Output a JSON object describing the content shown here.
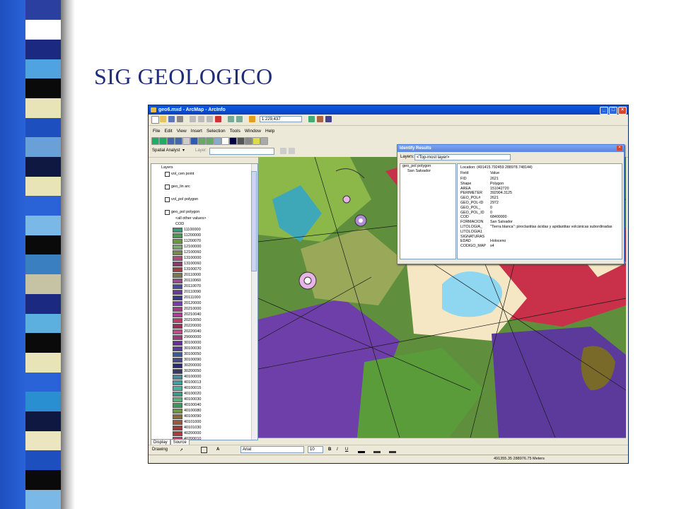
{
  "slide": {
    "title": "SIG GEOLOGICO"
  },
  "window": {
    "title": "geo6.mxd - ArcMap - ArcInfo",
    "scale": "1:229,437",
    "menu": [
      "File",
      "Edit",
      "View",
      "Insert",
      "Selection",
      "Tools",
      "Window",
      "Help"
    ],
    "spatial_analyst": "Spatial Analyst",
    "layer_label": "Layer:"
  },
  "toc": {
    "root": "Layers",
    "layers": [
      "vol_cen point",
      "geo_lin arc",
      "vol_pol polygon",
      "geo_pol polygon"
    ],
    "other_values": "<all other values>",
    "field": "COD",
    "codes": [
      "11100000",
      "11200000",
      "11200070",
      "12100000",
      "12100060",
      "13100000",
      "13100060",
      "13100070",
      "20110000",
      "20110060",
      "20110070",
      "20110090",
      "20111000",
      "20120000",
      "20210000",
      "20210040",
      "20210050",
      "20220000",
      "20220040",
      "29000000",
      "30100000",
      "30100030",
      "30100050",
      "30100090",
      "30200000",
      "30200050",
      "40100000",
      "40100013",
      "40100015",
      "40100020",
      "40100030",
      "40100040",
      "40100080",
      "40100090",
      "40101000",
      "40101030",
      "40200000",
      "40200010",
      "40200040"
    ],
    "tabs": [
      "Display",
      "Source"
    ]
  },
  "identify": {
    "title": "Identify Results",
    "layers_label": "Layers:",
    "layers_value": "<Top-most layer>",
    "tree_root": "geo_pol polygon",
    "tree_child": "San Salvador",
    "location": "Location: (491415.792459 288978.748144)",
    "headers": [
      "Field",
      "Value"
    ],
    "rows": [
      [
        "FID",
        "2621"
      ],
      [
        "Shape",
        "Polygon"
      ],
      [
        "AREA",
        "151042720"
      ],
      [
        "PERIMETER",
        "392904.3125"
      ],
      [
        "GEO_POL#",
        "2621"
      ],
      [
        "GEO_POL-ID",
        "2972"
      ],
      [
        "GEO_POL_",
        "0"
      ],
      [
        "GEO_POL_ID",
        "0"
      ],
      [
        "COD",
        "68400000"
      ],
      [
        "FORMACION",
        "San Salvador"
      ],
      [
        "LITOLOGIA_",
        "\"Tierra blanca\": piroclastitas ácidas y apidastitas volcánicas subordinadas"
      ],
      [
        "LITOLOGIA1",
        ""
      ],
      [
        "SIGNATURAS",
        ""
      ],
      [
        "EDAD",
        "Holoceno"
      ],
      [
        "CODIGO_MAP",
        "s4"
      ]
    ]
  },
  "drawing": {
    "label": "Drawing",
    "font": "Arial",
    "size": "10"
  },
  "status": {
    "coords": "491355.35  288976.75 Meters"
  },
  "colors": {
    "accent": "#1e4fbe",
    "title_blue": "#1f2d78",
    "xp_title": "#0b5ae8"
  }
}
